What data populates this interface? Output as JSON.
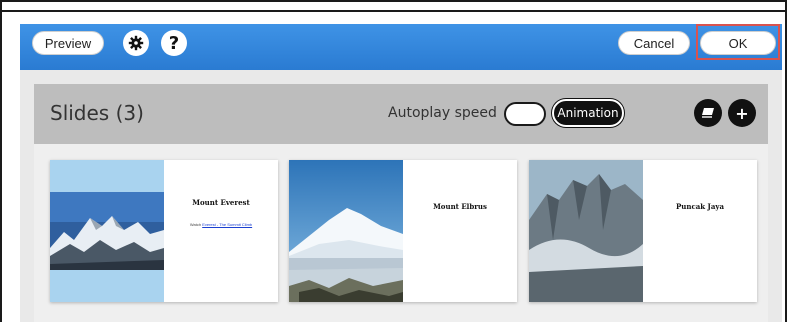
{
  "toolbar": {
    "preview_label": "Preview",
    "settings_icon": "gear-icon",
    "help_icon": "question-icon",
    "help_glyph": "?",
    "cancel_label": "Cancel",
    "ok_label": "OK"
  },
  "slides_panel": {
    "title": "Slides (3)",
    "autoplay_label": "Autoplay speed",
    "animation_label": "Animation",
    "duplicate_icon": "layers-icon",
    "add_icon": "plus-icon",
    "add_glyph": "+"
  },
  "slides": [
    {
      "title": "Mount Everest",
      "link_prefix": "Watch",
      "link_text": "Everest - The Summit Climb"
    },
    {
      "title": "Mount Elbrus"
    },
    {
      "title": "Puncak Jaya"
    }
  ],
  "colors": {
    "toolbar": "#2f86dd",
    "highlight": "#d9534f",
    "header": "#bdbdbd"
  }
}
